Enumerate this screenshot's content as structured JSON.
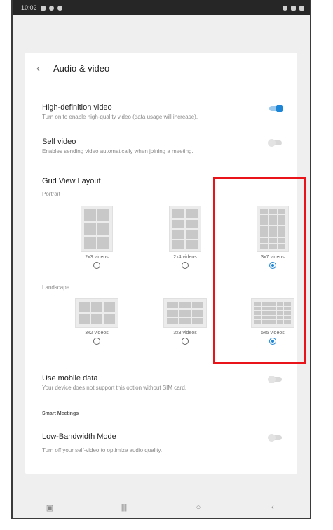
{
  "status_bar": {
    "time": "10:02"
  },
  "header": {
    "title": "Audio & video",
    "back_icon": "chevron-left-icon"
  },
  "settings": {
    "hd_video": {
      "title": "High-definition video",
      "subtitle": "Turn on to enable high-quality video (data usage will increase).",
      "enabled": true
    },
    "self_video": {
      "title": "Self video",
      "subtitle": "Enables sending video automatically when joining a meeting.",
      "enabled": false
    },
    "grid_view": {
      "title": "Grid View Layout",
      "portrait_label": "Portrait",
      "landscape_label": "Landscape",
      "portrait": [
        {
          "label": "2x3 videos",
          "selected": false
        },
        {
          "label": "2x4 videos",
          "selected": false
        },
        {
          "label": "3x7 videos",
          "selected": true
        }
      ],
      "landscape": [
        {
          "label": "3x2 videos",
          "selected": false
        },
        {
          "label": "3x3 videos",
          "selected": false
        },
        {
          "label": "5x5 videos",
          "selected": true
        }
      ]
    },
    "mobile_data": {
      "title": "Use mobile data",
      "subtitle": "Your device does not support this option without SIM card.",
      "enabled": false
    },
    "smart_meetings_label": "Smart Meetings",
    "low_bandwidth": {
      "title": "Low-Bandwidth Mode",
      "subtitle": "Turn off your self-video to optimize audio quality.",
      "enabled": false
    }
  },
  "colors": {
    "accent": "#1d86d6",
    "highlight": "#e8141a"
  }
}
